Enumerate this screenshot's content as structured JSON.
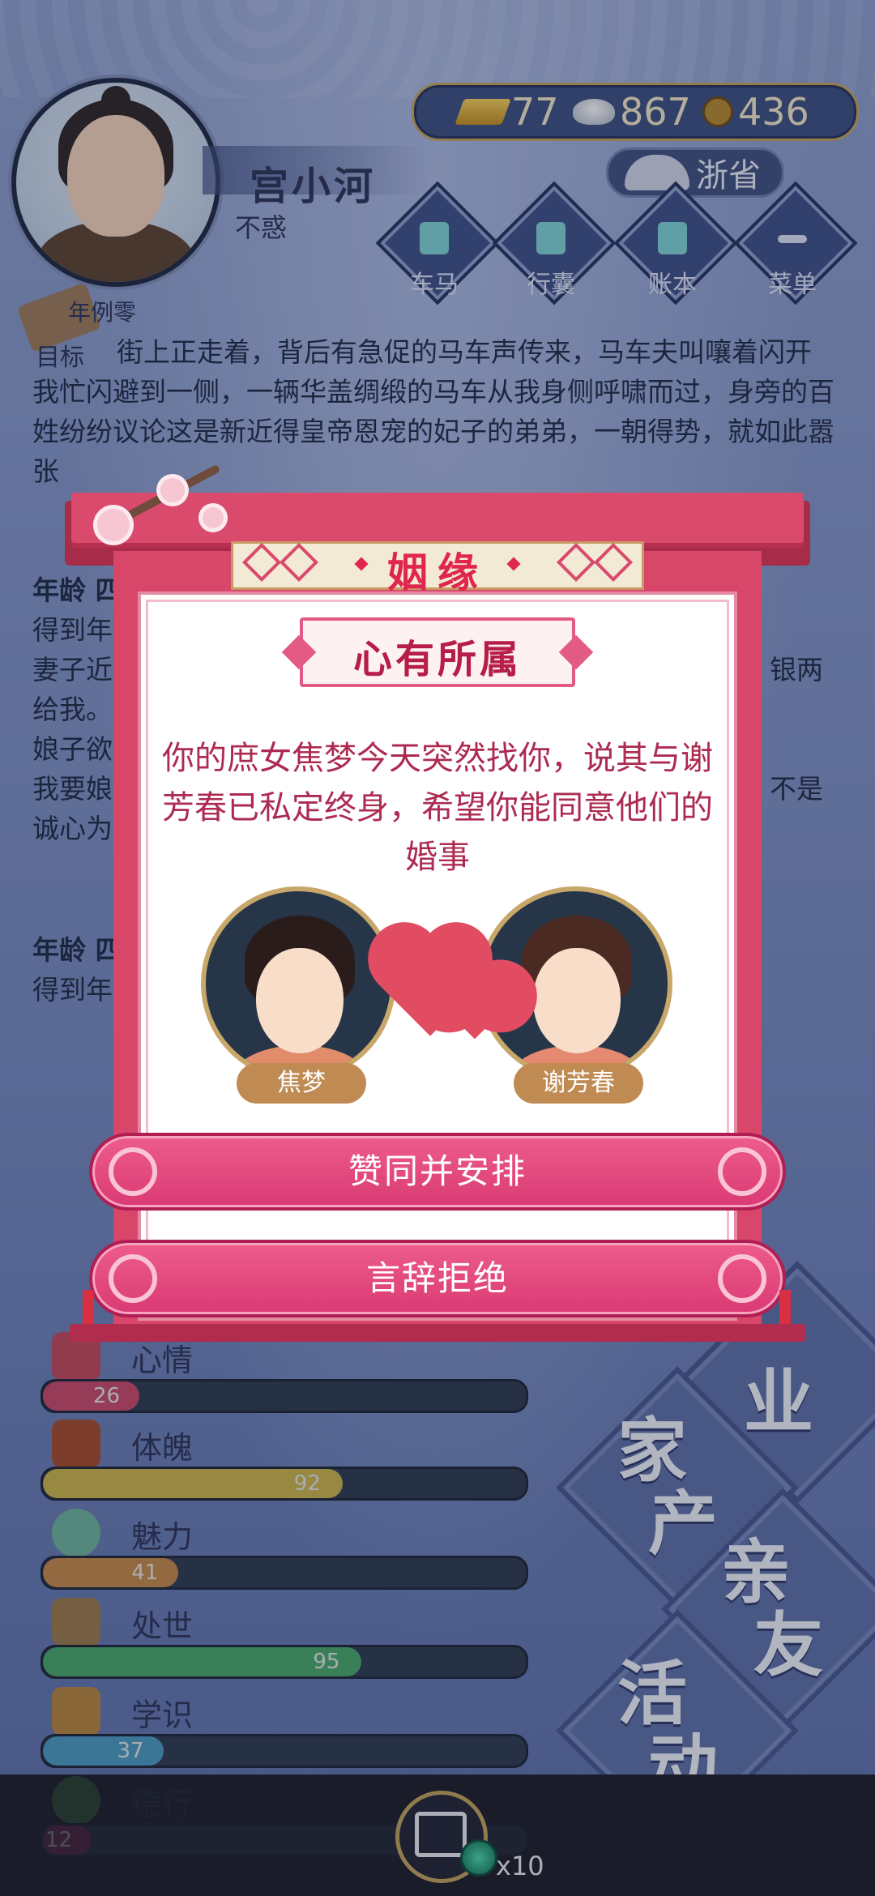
{
  "player": {
    "name": "宫小河",
    "age_label": "不惑"
  },
  "currency": {
    "gold": "77",
    "silver": "867",
    "coin": "436"
  },
  "province": "浙省",
  "top_nav": [
    {
      "label": "车马"
    },
    {
      "label": "行囊"
    },
    {
      "label": "账本"
    },
    {
      "label": "菜单"
    }
  ],
  "goal": {
    "label": "目标",
    "top_text": "年例零"
  },
  "story": {
    "p1": "街上正走着，背后有急促的马车声传来，马车夫叫嚷着闪开我忙闪避到一侧，一辆华盖绸缎的马车从我身侧呼啸而过，身旁的百姓纷纷议论这是新近得皇帝恩宠的妃子的弟弟，一朝得势，就如此嚣张",
    "p2_head": "年龄 四",
    "p2_lines": [
      "得到年",
      "妻子近",
      "给我。",
      "娘子欲",
      "我要娘",
      "诚心为"
    ],
    "p2_right": [
      "银两",
      "不是"
    ],
    "p3_head": "年龄 四",
    "p3_line": "得到年"
  },
  "stats": [
    {
      "label": "心情",
      "value": 26,
      "fill_pct": 0.2,
      "color": "#c84a6a"
    },
    {
      "label": "体魄",
      "value": 92,
      "fill_pct": 0.62,
      "color": "#c9b34a"
    },
    {
      "label": "魅力",
      "value": 41,
      "fill_pct": 0.28,
      "color": "#c48848"
    },
    {
      "label": "处世",
      "value": 95,
      "fill_pct": 0.66,
      "color": "#47a86a"
    },
    {
      "label": "学识",
      "value": 37,
      "fill_pct": 0.25,
      "color": "#4a9ac0"
    },
    {
      "label": "德行",
      "value": 12,
      "fill_pct": 0.1,
      "color": "#8a2a58"
    }
  ],
  "big_tiles": [
    {
      "t1": "家",
      "t2": "产"
    },
    {
      "t1": "亲",
      "t2": "友"
    },
    {
      "t1": "活",
      "t2": "动"
    },
    {
      "t1": "",
      "t2": "业"
    }
  ],
  "share": {
    "count_label": "x10"
  },
  "dialog": {
    "title": "姻缘",
    "subtitle": "心有所属",
    "message": "你的庶女焦梦今天突然找你，说其与谢芳春已私定终身，希望你能同意他们的婚事",
    "left_person": "焦梦",
    "right_person": "谢芳春",
    "accept_label": "赞同并安排",
    "reject_label": "言辞拒绝"
  },
  "colors": {
    "dialog_primary": "#d8476a",
    "dialog_text": "#ad2b52",
    "accent_title": "#e0264f"
  }
}
